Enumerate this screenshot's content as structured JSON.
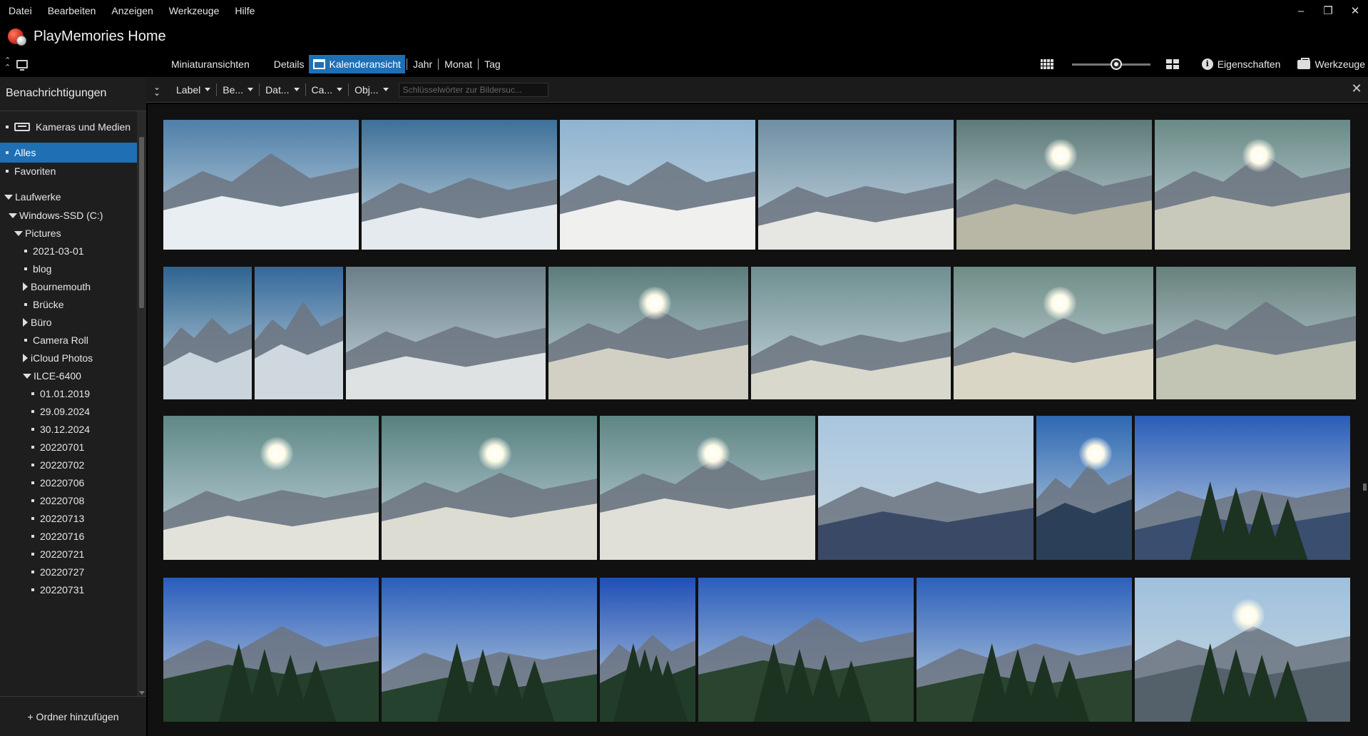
{
  "menu": [
    "Datei",
    "Bearbeiten",
    "Anzeigen",
    "Werkzeuge",
    "Hilfe"
  ],
  "window_controls": [
    "–",
    "❐",
    "✕"
  ],
  "app": {
    "title": "PlayMemories Home"
  },
  "view_tabs": {
    "thumbnails": "Miniaturansichten",
    "details": "Details",
    "calendar": "Kalenderansicht",
    "year": "Jahr",
    "month": "Monat",
    "day": "Tag",
    "active": "calendar"
  },
  "toolbar_right": {
    "properties": "Eigenschaften",
    "tools": "Werkzeuge",
    "zoom_level": 0.5
  },
  "sidebar": {
    "header": "Benachrichtigungen",
    "footer": "+ Ordner hinzufügen",
    "items": [
      {
        "label": "Kameras und Medien",
        "type": "camera",
        "indent": 0
      },
      {
        "label": "Alles",
        "type": "bullet",
        "indent": 0,
        "selected": true
      },
      {
        "label": "Favoriten",
        "type": "bullet",
        "indent": 0
      },
      {
        "label": "Laufwerke",
        "type": "expanded",
        "indent": 0
      },
      {
        "label": "Windows-SSD (C:)",
        "type": "expanded",
        "indent": 1
      },
      {
        "label": "Pictures",
        "type": "expanded",
        "indent": 2
      },
      {
        "label": "2021-03-01",
        "type": "bullet",
        "indent": 3
      },
      {
        "label": "blog",
        "type": "bullet",
        "indent": 3
      },
      {
        "label": "Bournemouth",
        "type": "collapsed",
        "indent": 3
      },
      {
        "label": "Brücke",
        "type": "bullet",
        "indent": 3
      },
      {
        "label": "Büro",
        "type": "collapsed",
        "indent": 3
      },
      {
        "label": "Camera Roll",
        "type": "bullet",
        "indent": 3
      },
      {
        "label": "iCloud Photos",
        "type": "collapsed",
        "indent": 3
      },
      {
        "label": "ILCE-6400",
        "type": "expanded",
        "indent": 3
      },
      {
        "label": "01.01.2019",
        "type": "bullet",
        "indent": 4
      },
      {
        "label": "29.09.2024",
        "type": "bullet",
        "indent": 4
      },
      {
        "label": "30.12.2024",
        "type": "bullet",
        "indent": 4
      },
      {
        "label": "20220701",
        "type": "bullet",
        "indent": 4
      },
      {
        "label": "20220702",
        "type": "bullet",
        "indent": 4
      },
      {
        "label": "20220706",
        "type": "bullet",
        "indent": 4
      },
      {
        "label": "20220708",
        "type": "bullet",
        "indent": 4
      },
      {
        "label": "20220713",
        "type": "bullet",
        "indent": 4
      },
      {
        "label": "20220716",
        "type": "bullet",
        "indent": 4
      },
      {
        "label": "20220721",
        "type": "bullet",
        "indent": 4
      },
      {
        "label": "20220727",
        "type": "bullet",
        "indent": 4
      },
      {
        "label": "20220731",
        "type": "bullet",
        "indent": 4
      }
    ]
  },
  "filters": {
    "dropdowns": [
      "Label",
      "Be...",
      "Dat...",
      "Ca...",
      "Obj..."
    ],
    "search_placeholder": "Schlüsselwörter zur Bildersuc..."
  },
  "photo_rows": [
    {
      "photos": [
        {
          "sky": "#4f7fa8",
          "ground": "#e8eef2",
          "sun": false
        },
        {
          "sky": "#3e7098",
          "ground": "#e4eaee",
          "sun": false
        },
        {
          "sky": "#8fb3d0",
          "ground": "#f0f0ee",
          "sun": false
        },
        {
          "sky": "#6f8fa2",
          "ground": "#e6e6e2",
          "sun": false
        },
        {
          "sky": "#5d7a78",
          "ground": "#b8b6a4",
          "sun": true
        },
        {
          "sky": "#6a8a86",
          "ground": "#c9c9bb",
          "sun": true
        }
      ]
    },
    {
      "photos": [
        {
          "sky": "#2e6490",
          "ground": "#c9d4dc",
          "sun": false
        },
        {
          "sky": "#34689a",
          "ground": "#cfd8de",
          "sun": false
        },
        {
          "sky": "#6a7f88",
          "ground": "#dfe2e2",
          "sun": false
        },
        {
          "sky": "#5b7c7a",
          "ground": "#d2d0c4",
          "sun": true
        },
        {
          "sky": "#6f8f90",
          "ground": "#d8d8cc",
          "sun": false
        },
        {
          "sky": "#6f8d86",
          "ground": "#dad6c6",
          "sun": true
        },
        {
          "sky": "#67817c",
          "ground": "#c2c4b4",
          "sun": false
        }
      ]
    },
    {
      "photos": [
        {
          "sky": "#5f8886",
          "ground": "#e2e2da",
          "sun": true
        },
        {
          "sky": "#57807e",
          "ground": "#dcdcd2",
          "sun": true
        },
        {
          "sky": "#5e8583",
          "ground": "#e0e0d8",
          "sun": true
        },
        {
          "sky": "#a9c6de",
          "ground": "#3a4a66",
          "sun": false
        },
        {
          "sky": "#2e68b2",
          "ground": "#2b4058",
          "sun": true
        },
        {
          "sky": "#2a5cb8",
          "ground": "#3a4e70",
          "sun": false
        }
      ]
    },
    {
      "photos": [
        {
          "sky": "#2a5cbc",
          "ground": "#24402c",
          "sun": false
        },
        {
          "sky": "#2b5eba",
          "ground": "#25422e",
          "sun": false
        },
        {
          "sky": "#1f4fb6",
          "ground": "#223c2a",
          "sun": false
        },
        {
          "sky": "#2b5ebc",
          "ground": "#2a4430",
          "sun": false
        },
        {
          "sky": "#2c60ba",
          "ground": "#2a4430",
          "sun": false
        },
        {
          "sky": "#9fc0dc",
          "ground": "#54606a",
          "sun": true
        }
      ]
    }
  ]
}
